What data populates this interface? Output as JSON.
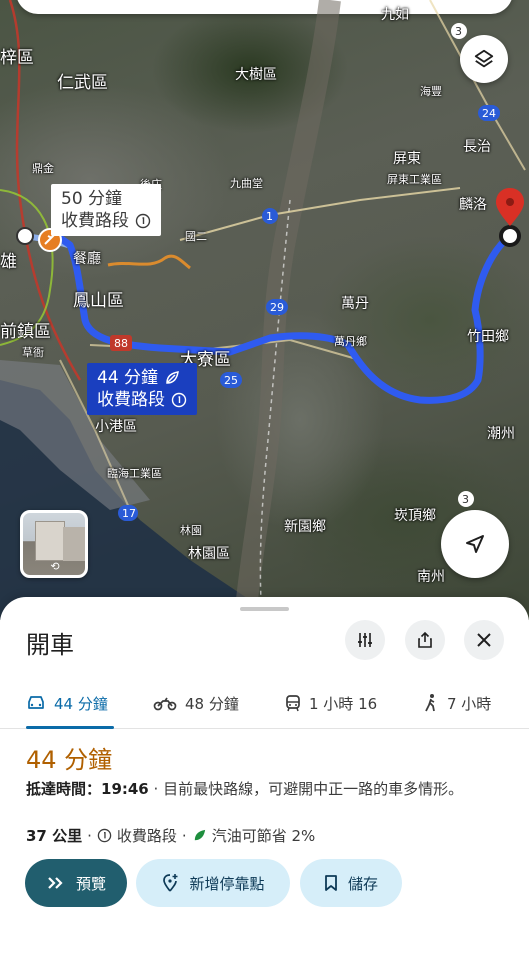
{
  "map": {
    "labels": {
      "jiuru": "九如",
      "qiaotou_area": "梓區",
      "renwu": "仁武區",
      "dashu": "大樹區",
      "haifeng": "海豐",
      "changzhi": "長治",
      "pingtung": "屏東",
      "pingtung_industrial": "屏東工業區",
      "linluo": "麟洛",
      "dingshe": "鼎金",
      "houzhuang": "後庄",
      "jiukuaicuo": "九曲堂",
      "kaohsiung_edge": "雄",
      "restaurant": "餐廳",
      "fengshan": "鳳山區",
      "road_1": "1",
      "road_29": "29",
      "road_88": "88",
      "road_25": "25",
      "road_24": "24",
      "road_17": "17",
      "road_3a": "3",
      "road_3b": "3",
      "wandan": "萬丹",
      "wandan_town": "萬丹鄉",
      "zhutian": "竹田鄉",
      "qianzhen": "前鎮區",
      "caoya": "草衙",
      "daliao": "大寮區",
      "xiaogang": "小港區",
      "linhai": "臨海工業區",
      "chaozhou": "潮州",
      "kanding": "崁頂鄉",
      "xinyuan": "新園鄉",
      "linyuan": "林園",
      "linyuan_area": "林園區",
      "nanzhou": "南州",
      "guoer": "國二"
    },
    "route_primary": {
      "time": "44 分鐘",
      "toll": "收費路段"
    },
    "route_alt": {
      "time": "50 分鐘",
      "toll": "收費路段"
    }
  },
  "sheet": {
    "title": "開車",
    "tabs": [
      {
        "label": "44 分鐘",
        "icon": "car-icon",
        "active": true
      },
      {
        "label": "48 分鐘",
        "icon": "motorcycle-icon",
        "active": false
      },
      {
        "label": "1 小時 16",
        "icon": "transit-icon",
        "active": false
      },
      {
        "label": "7 小時",
        "icon": "walk-icon",
        "active": false
      }
    ],
    "duration": "44 分鐘",
    "arrival_label": "抵達時間：19:46",
    "description": "· 目前最快路線，可避開中正一路的車多情形。",
    "distance": "37 公里",
    "toll_label": "收費路段",
    "fuel_label": "汽油可節省 2%",
    "buttons": {
      "preview": "預覽",
      "add_stop": "新增停靠點",
      "save": "儲存"
    }
  },
  "colors": {
    "route_blue": "#2f5bf0",
    "accent_teal": "#215e6e",
    "duration_orange": "#b06000",
    "tab_blue": "#0b6ba8",
    "destination_red": "#d93025"
  }
}
